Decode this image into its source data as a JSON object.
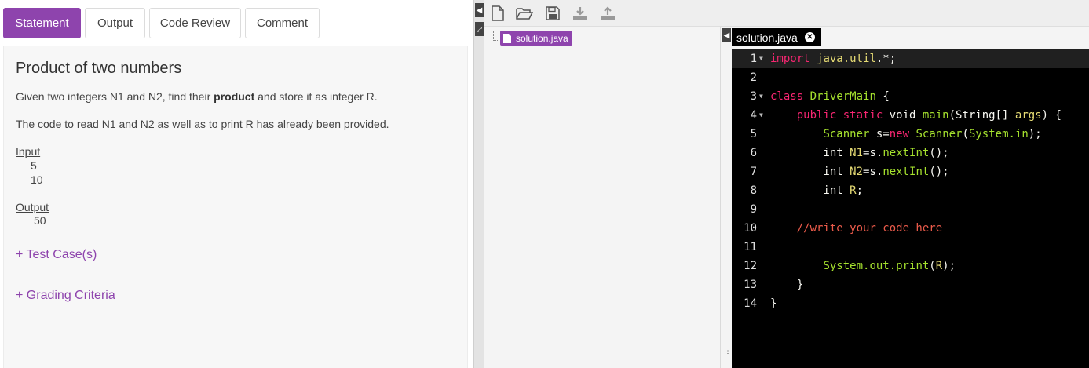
{
  "tabs": [
    {
      "label": "Statement",
      "active": true
    },
    {
      "label": "Output",
      "active": false
    },
    {
      "label": "Code Review",
      "active": false
    },
    {
      "label": "Comment",
      "active": false
    }
  ],
  "statement": {
    "title": "Product of two numbers",
    "para1_prefix": "Given two integers N1 and N2, find their ",
    "para1_bold": "product",
    "para1_suffix": " and store it as integer R.",
    "para2": "The code to read N1 and N2 as well as to print R has already been provided.",
    "input_label": "Input",
    "input_values": [
      "5",
      "10"
    ],
    "output_label": "Output",
    "output_values": [
      "50"
    ],
    "test_cases": "+ Test Case(s)",
    "grading": "+ Grading Criteria"
  },
  "toolbar": {
    "icons": [
      "new-file-icon",
      "open-folder-icon",
      "save-icon",
      "download-icon",
      "upload-icon"
    ]
  },
  "file_tree": {
    "file": "solution.java"
  },
  "editor": {
    "tab_label": "solution.java",
    "lines": [
      {
        "n": "1",
        "fold": true,
        "tokens": [
          [
            "kw",
            "import"
          ],
          [
            "pl",
            " "
          ],
          [
            "id",
            "java.util"
          ],
          [
            "pl",
            ".*;"
          ]
        ]
      },
      {
        "n": "2",
        "fold": false,
        "tokens": []
      },
      {
        "n": "3",
        "fold": true,
        "tokens": [
          [
            "kw",
            "class"
          ],
          [
            "pl",
            " "
          ],
          [
            "cls",
            "DriverMain"
          ],
          [
            "pl",
            " {"
          ]
        ]
      },
      {
        "n": "4",
        "fold": true,
        "tokens": [
          [
            "pl",
            "    "
          ],
          [
            "kw",
            "public static"
          ],
          [
            "pl",
            " void "
          ],
          [
            "cls",
            "main"
          ],
          [
            "pl",
            "(String[] "
          ],
          [
            "id",
            "args"
          ],
          [
            "pl",
            ") {"
          ]
        ]
      },
      {
        "n": "5",
        "fold": false,
        "tokens": [
          [
            "pl",
            "        "
          ],
          [
            "cls",
            "Scanner"
          ],
          [
            "pl",
            " s="
          ],
          [
            "kw",
            "new"
          ],
          [
            "pl",
            " "
          ],
          [
            "cls",
            "Scanner"
          ],
          [
            "pl",
            "("
          ],
          [
            "cls",
            "System.in"
          ],
          [
            "pl",
            ");"
          ]
        ]
      },
      {
        "n": "6",
        "fold": false,
        "tokens": [
          [
            "pl",
            "        int "
          ],
          [
            "id",
            "N1"
          ],
          [
            "pl",
            "=s."
          ],
          [
            "cls",
            "nextInt"
          ],
          [
            "pl",
            "();"
          ]
        ]
      },
      {
        "n": "7",
        "fold": false,
        "tokens": [
          [
            "pl",
            "        int "
          ],
          [
            "id",
            "N2"
          ],
          [
            "pl",
            "=s."
          ],
          [
            "cls",
            "nextInt"
          ],
          [
            "pl",
            "();"
          ]
        ]
      },
      {
        "n": "8",
        "fold": false,
        "tokens": [
          [
            "pl",
            "        int "
          ],
          [
            "id",
            "R"
          ],
          [
            "pl",
            ";"
          ]
        ]
      },
      {
        "n": "9",
        "fold": false,
        "tokens": []
      },
      {
        "n": "10",
        "fold": false,
        "tokens": [
          [
            "pl",
            "    "
          ],
          [
            "cm",
            "//write your code here"
          ]
        ]
      },
      {
        "n": "11",
        "fold": false,
        "tokens": []
      },
      {
        "n": "12",
        "fold": false,
        "tokens": [
          [
            "pl",
            "        "
          ],
          [
            "cls",
            "System.out.print"
          ],
          [
            "pl",
            "("
          ],
          [
            "id",
            "R"
          ],
          [
            "pl",
            ");"
          ]
        ]
      },
      {
        "n": "13",
        "fold": false,
        "tokens": [
          [
            "pl",
            "    }"
          ]
        ]
      },
      {
        "n": "14",
        "fold": false,
        "tokens": [
          [
            "pl",
            "}"
          ]
        ]
      }
    ]
  },
  "colors": {
    "accent": "#8e44ad",
    "editor_bg": "#000000",
    "keyword": "#f92672",
    "class_name": "#a6e22e",
    "identifier": "#e6db74",
    "comment": "#ec5b4b"
  }
}
